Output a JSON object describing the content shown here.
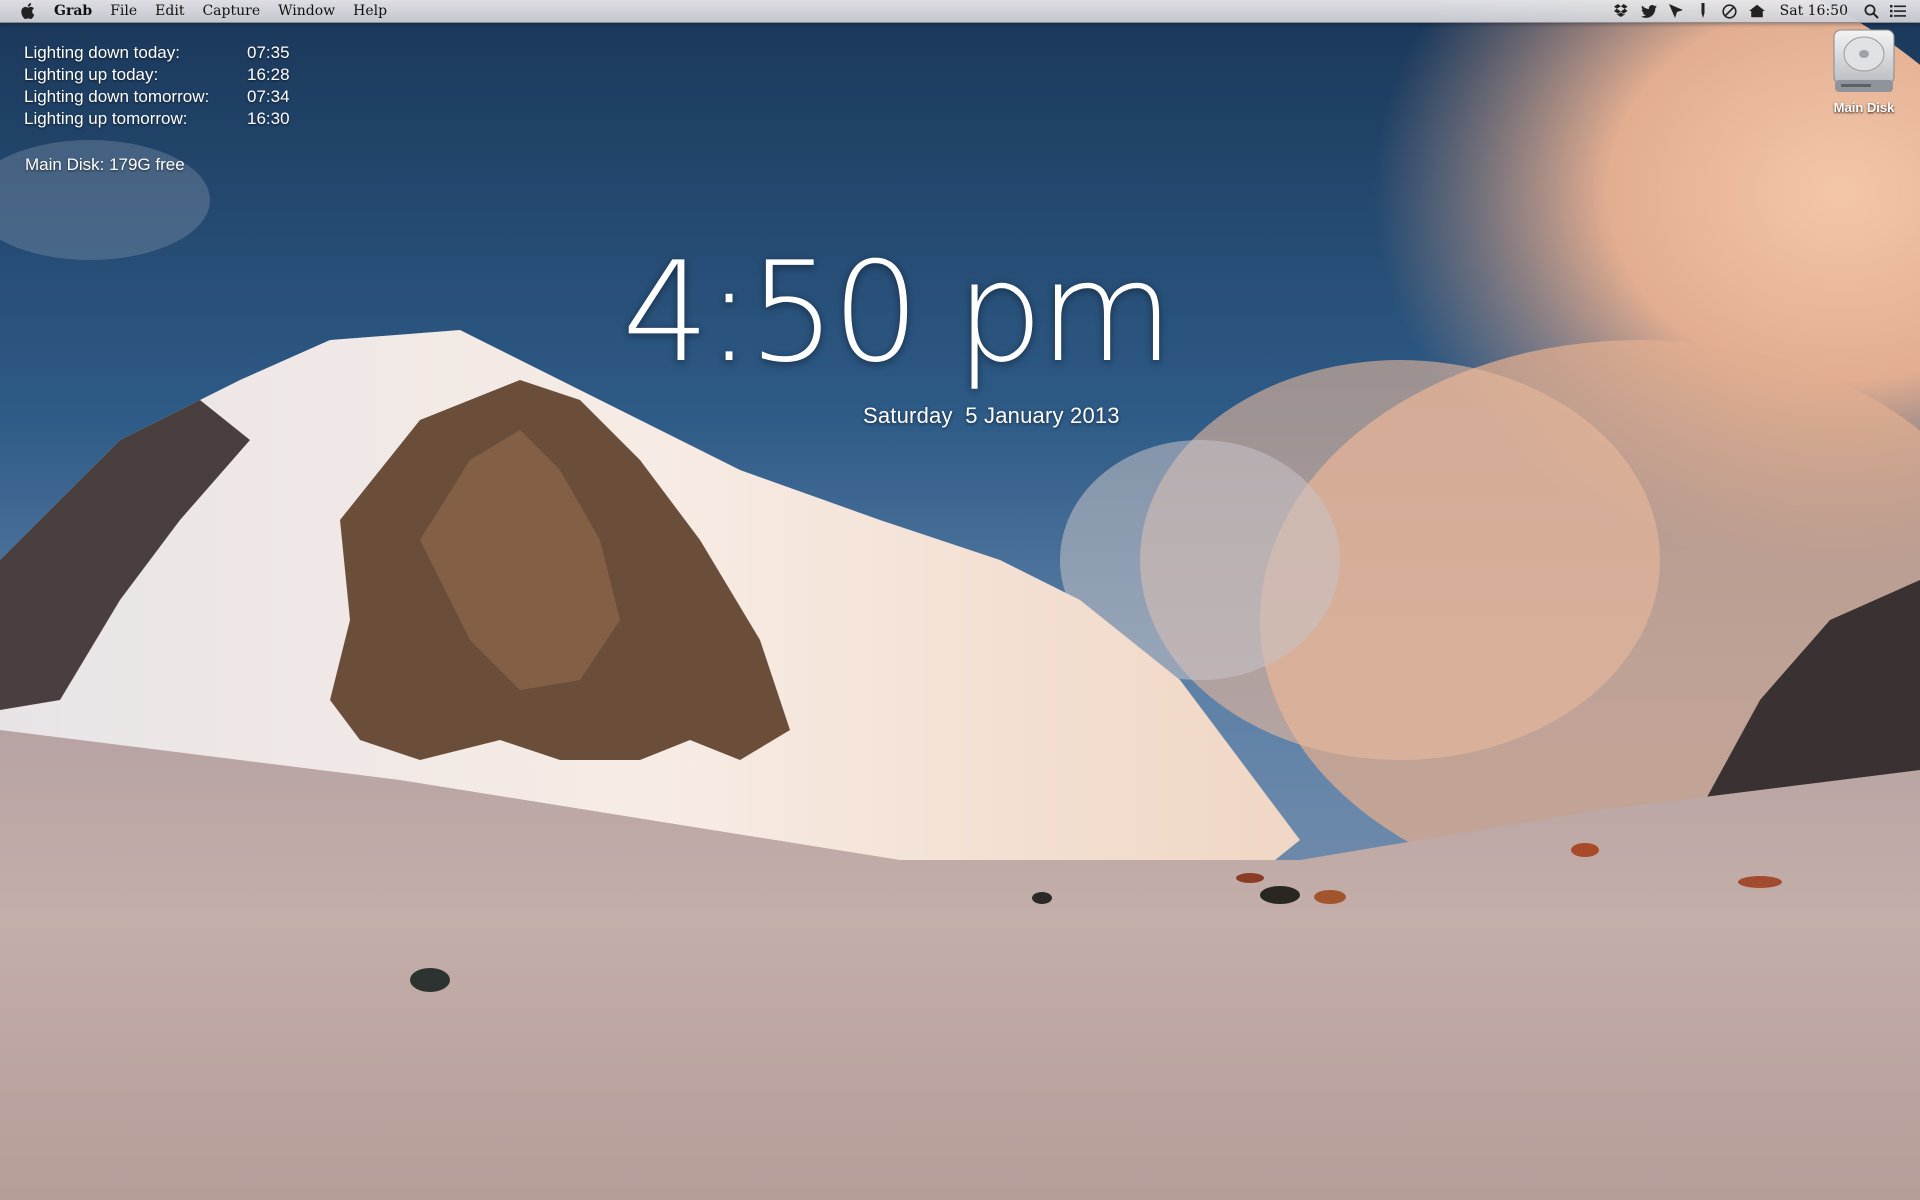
{
  "menubar": {
    "apple_icon": "apple-logo-icon",
    "app_name": "Grab",
    "menus": [
      "File",
      "Edit",
      "Capture",
      "Window",
      "Help"
    ],
    "status_icons": [
      "dropbox-icon",
      "twitter-icon",
      "location-arrow-icon",
      "pen-icon",
      "clock-icon",
      "home-icon"
    ],
    "clock": "Sat 16:50",
    "search_icon": "spotlight-search-icon",
    "list_icon": "notification-center-icon"
  },
  "info": {
    "rows": [
      {
        "label": "Lighting down today:",
        "value": "07:35"
      },
      {
        "label": "Lighting up today:",
        "value": "16:28"
      },
      {
        "label": "Lighting down tomorrow:",
        "value": "07:34"
      },
      {
        "label": "Lighting up tomorrow:",
        "value": "16:30"
      }
    ],
    "disk_free": "Main Disk: 179G free"
  },
  "clock": {
    "time": "4:50 pm",
    "date": "Saturday  5 January 2013"
  },
  "desktop_icons": [
    {
      "label": "Main Disk",
      "icon": "hard-drive-icon"
    }
  ],
  "colors": {
    "sky": "#2d5a86",
    "snow": "#ece0d8",
    "cloud": "#e8b79a",
    "text": "#ffffff"
  }
}
